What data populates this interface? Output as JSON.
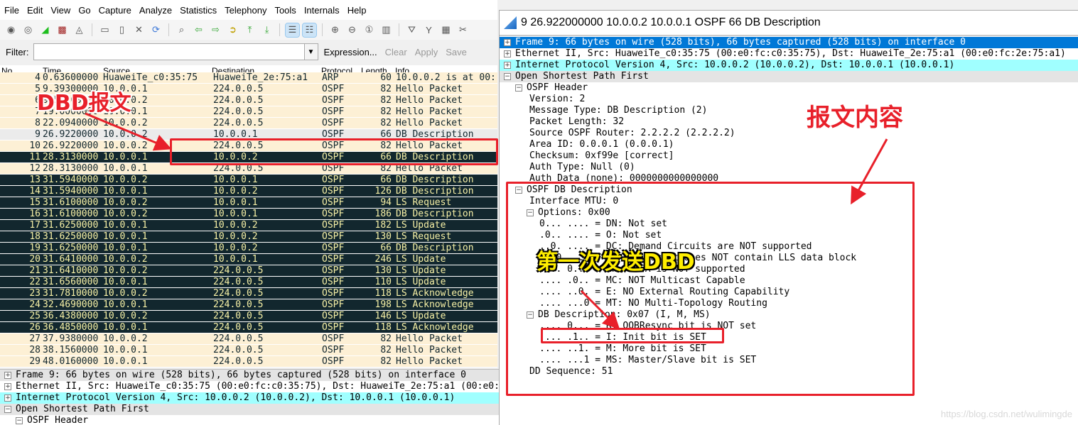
{
  "menu": [
    "File",
    "Edit",
    "View",
    "Go",
    "Capture",
    "Analyze",
    "Statistics",
    "Telephony",
    "Tools",
    "Internals",
    "Help"
  ],
  "toolbar_icons": [
    "interfaces-icon",
    "options-icon",
    "start-capture-icon",
    "stop-capture-icon",
    "restart-capture-icon",
    "open-file-icon",
    "save-file-icon",
    "close-file-icon",
    "reload-icon",
    "find-icon",
    "back-icon",
    "forward-icon",
    "goto-icon",
    "first-packet-icon",
    "last-packet-icon",
    "colorize-icon",
    "autoscroll-icon",
    "zoom-in-icon",
    "zoom-out-icon",
    "zoom-normal-icon",
    "resize-columns-icon",
    "capture-filters-icon",
    "display-filters-icon",
    "coloring-rules-icon",
    "preferences-icon"
  ],
  "filter": {
    "label": "Filter:",
    "value": "",
    "expression": "Expression...",
    "clear": "Clear",
    "apply": "Apply",
    "save": "Save"
  },
  "columns": [
    "No.",
    "Time",
    "Source",
    "Destination",
    "Protocol",
    "Length",
    "Info"
  ],
  "packets": [
    {
      "no": "4",
      "time": "0.63600000",
      "src": "HuaweiTe_c0:35:75",
      "dst": "HuaweiTe_2e:75:a1",
      "proto": "ARP",
      "len": "60",
      "info": "10.0.0.2 is at 00:",
      "style": "light"
    },
    {
      "no": "5",
      "time": "9.39300000",
      "src": "10.0.0.1",
      "dst": "224.0.0.5",
      "proto": "OSPF",
      "len": "82",
      "info": "Hello Packet",
      "style": "light"
    },
    {
      "no": "6",
      "time": "9.50000000",
      "src": "10.0.0.2",
      "dst": "224.0.0.5",
      "proto": "OSPF",
      "len": "82",
      "info": "Hello Packet",
      "style": "light"
    },
    {
      "no": "7",
      "time": "19.0000000",
      "src": "10.0.0.1",
      "dst": "224.0.0.5",
      "proto": "OSPF",
      "len": "82",
      "info": "Hello Packet",
      "style": "light"
    },
    {
      "no": "8",
      "time": "22.0940000",
      "src": "10.0.0.2",
      "dst": "224.0.0.5",
      "proto": "OSPF",
      "len": "82",
      "info": "Hello Packet",
      "style": "light"
    },
    {
      "no": "9",
      "time": "26.9220000",
      "src": "10.0.0.2",
      "dst": "10.0.0.1",
      "proto": "OSPF",
      "len": "66",
      "info": "DB Description",
      "style": "gray"
    },
    {
      "no": "10",
      "time": "26.9220000",
      "src": "10.0.0.2",
      "dst": "224.0.0.5",
      "proto": "OSPF",
      "len": "82",
      "info": "Hello Packet",
      "style": "light"
    },
    {
      "no": "11",
      "time": "28.3130000",
      "src": "10.0.0.1",
      "dst": "10.0.0.2",
      "proto": "OSPF",
      "len": "66",
      "info": "DB Description",
      "style": "dark"
    },
    {
      "no": "12",
      "time": "28.3130000",
      "src": "10.0.0.1",
      "dst": "224.0.0.5",
      "proto": "OSPF",
      "len": "82",
      "info": "Hello Packet",
      "style": "light"
    },
    {
      "no": "13",
      "time": "31.5940000",
      "src": "10.0.0.2",
      "dst": "10.0.0.1",
      "proto": "OSPF",
      "len": "66",
      "info": "DB Description",
      "style": "dark"
    },
    {
      "no": "14",
      "time": "31.5940000",
      "src": "10.0.0.1",
      "dst": "10.0.0.2",
      "proto": "OSPF",
      "len": "126",
      "info": "DB Description",
      "style": "dark"
    },
    {
      "no": "15",
      "time": "31.6100000",
      "src": "10.0.0.2",
      "dst": "10.0.0.1",
      "proto": "OSPF",
      "len": "94",
      "info": "LS Request",
      "style": "dark"
    },
    {
      "no": "16",
      "time": "31.6100000",
      "src": "10.0.0.2",
      "dst": "10.0.0.1",
      "proto": "OSPF",
      "len": "186",
      "info": "DB Description",
      "style": "dark"
    },
    {
      "no": "17",
      "time": "31.6250000",
      "src": "10.0.0.1",
      "dst": "10.0.0.2",
      "proto": "OSPF",
      "len": "182",
      "info": "LS Update",
      "style": "dark"
    },
    {
      "no": "18",
      "time": "31.6250000",
      "src": "10.0.0.1",
      "dst": "10.0.0.2",
      "proto": "OSPF",
      "len": "130",
      "info": "LS Request",
      "style": "dark"
    },
    {
      "no": "19",
      "time": "31.6250000",
      "src": "10.0.0.1",
      "dst": "10.0.0.2",
      "proto": "OSPF",
      "len": "66",
      "info": "DB Description",
      "style": "dark"
    },
    {
      "no": "20",
      "time": "31.6410000",
      "src": "10.0.0.2",
      "dst": "10.0.0.1",
      "proto": "OSPF",
      "len": "246",
      "info": "LS Update",
      "style": "dark"
    },
    {
      "no": "21",
      "time": "31.6410000",
      "src": "10.0.0.2",
      "dst": "224.0.0.5",
      "proto": "OSPF",
      "len": "130",
      "info": "LS Update",
      "style": "dark"
    },
    {
      "no": "22",
      "time": "31.6560000",
      "src": "10.0.0.1",
      "dst": "224.0.0.5",
      "proto": "OSPF",
      "len": "110",
      "info": "LS Update",
      "style": "dark"
    },
    {
      "no": "23",
      "time": "31.7810000",
      "src": "10.0.0.2",
      "dst": "224.0.0.5",
      "proto": "OSPF",
      "len": "118",
      "info": "LS Acknowledge",
      "style": "dark"
    },
    {
      "no": "24",
      "time": "32.4690000",
      "src": "10.0.0.1",
      "dst": "224.0.0.5",
      "proto": "OSPF",
      "len": "198",
      "info": "LS Acknowledge",
      "style": "dark"
    },
    {
      "no": "25",
      "time": "36.4380000",
      "src": "10.0.0.2",
      "dst": "224.0.0.5",
      "proto": "OSPF",
      "len": "146",
      "info": "LS Update",
      "style": "dark"
    },
    {
      "no": "26",
      "time": "36.4850000",
      "src": "10.0.0.1",
      "dst": "224.0.0.5",
      "proto": "OSPF",
      "len": "118",
      "info": "LS Acknowledge",
      "style": "dark"
    },
    {
      "no": "27",
      "time": "37.9380000",
      "src": "10.0.0.2",
      "dst": "224.0.0.5",
      "proto": "OSPF",
      "len": "82",
      "info": "Hello Packet",
      "style": "light"
    },
    {
      "no": "28",
      "time": "38.1560000",
      "src": "10.0.0.1",
      "dst": "224.0.0.5",
      "proto": "OSPF",
      "len": "82",
      "info": "Hello Packet",
      "style": "light"
    },
    {
      "no": "29",
      "time": "48.0160000",
      "src": "10.0.0.1",
      "dst": "224.0.0.5",
      "proto": "OSPF",
      "len": "82",
      "info": "Hello Packet",
      "style": "light"
    }
  ],
  "bottom_tree": [
    {
      "text": "Frame 9: 66 bytes on wire (528 bits), 66 bytes captured (528 bits) on interface 0",
      "exp": "+",
      "indent": 0,
      "style": "grayb"
    },
    {
      "text": "Ethernet II, Src: HuaweiTe_c0:35:75 (00:e0:fc:c0:35:75), Dst: HuaweiTe_2e:75:a1 (00:e0:fc:2e:75:a1)",
      "exp": "+",
      "indent": 0,
      "style": ""
    },
    {
      "text": "Internet Protocol Version 4, Src: 10.0.0.2 (10.0.0.2), Dst: 10.0.0.1 (10.0.0.1)",
      "exp": "+",
      "indent": 0,
      "style": "cyan"
    },
    {
      "text": "Open Shortest Path First",
      "exp": "-",
      "indent": 0,
      "style": "grayb"
    },
    {
      "text": "OSPF Header",
      "exp": "-",
      "indent": 1,
      "style": ""
    }
  ],
  "detail_window": {
    "title": "9 26.922000000 10.0.0.2 10.0.0.1 OSPF 66 DB Description",
    "tree": [
      {
        "text": "Frame 9: 66 bytes on wire (528 bits), 66 bytes captured (528 bits) on interface 0",
        "exp": "+",
        "indent": 0,
        "style": "sel"
      },
      {
        "text": "Ethernet II, Src: HuaweiTe_c0:35:75 (00:e0:fc:c0:35:75), Dst: HuaweiTe_2e:75:a1 (00:e0:fc:2e:75:a1)",
        "exp": "+",
        "indent": 0,
        "style": ""
      },
      {
        "text": "Internet Protocol Version 4, Src: 10.0.0.2 (10.0.0.2), Dst: 10.0.0.1 (10.0.0.1)",
        "exp": "+",
        "indent": 0,
        "style": "cyan"
      },
      {
        "text": "Open Shortest Path First",
        "exp": "-",
        "indent": 0,
        "style": "grayb"
      },
      {
        "text": "OSPF Header",
        "exp": "-",
        "indent": 1,
        "style": ""
      },
      {
        "text": "Version: 2",
        "exp": "",
        "indent": 2,
        "style": ""
      },
      {
        "text": "Message Type: DB Description (2)",
        "exp": "",
        "indent": 2,
        "style": ""
      },
      {
        "text": "Packet Length: 32",
        "exp": "",
        "indent": 2,
        "style": ""
      },
      {
        "text": "Source OSPF Router: 2.2.2.2 (2.2.2.2)",
        "exp": "",
        "indent": 2,
        "style": ""
      },
      {
        "text": "Area ID: 0.0.0.1 (0.0.0.1)",
        "exp": "",
        "indent": 2,
        "style": ""
      },
      {
        "text": "Checksum: 0xf99e [correct]",
        "exp": "",
        "indent": 2,
        "style": ""
      },
      {
        "text": "Auth Type: Null (0)",
        "exp": "",
        "indent": 2,
        "style": ""
      },
      {
        "text": "Auth Data (none): 0000000000000000",
        "exp": "",
        "indent": 2,
        "style": ""
      },
      {
        "text": "OSPF DB Description",
        "exp": "-",
        "indent": 1,
        "style": ""
      },
      {
        "text": "Interface MTU: 0",
        "exp": "",
        "indent": 2,
        "style": ""
      },
      {
        "text": "Options: 0x00",
        "exp": "-",
        "indent": 2,
        "style": ""
      },
      {
        "text": "0... .... = DN: Not set",
        "exp": "",
        "indent": 3,
        "style": ""
      },
      {
        "text": ".0.. .... = O: Not set",
        "exp": "",
        "indent": 3,
        "style": ""
      },
      {
        "text": "..0. .... = DC: Demand Circuits are NOT supported",
        "exp": "",
        "indent": 3,
        "style": ""
      },
      {
        "text": "...0 .... = L: The packet does NOT contain LLS data block",
        "exp": "",
        "indent": 3,
        "style": ""
      },
      {
        "text": ".... 0... = NP: NSSA is NOT supported",
        "exp": "",
        "indent": 3,
        "style": ""
      },
      {
        "text": ".... .0.. = MC: NOT Multicast Capable",
        "exp": "",
        "indent": 3,
        "style": ""
      },
      {
        "text": ".... ..0. = E: NO External Routing Capability",
        "exp": "",
        "indent": 3,
        "style": ""
      },
      {
        "text": ".... ...0 = MT: NO Multi-Topology Routing",
        "exp": "",
        "indent": 3,
        "style": ""
      },
      {
        "text": "DB Description: 0x07 (I, M, MS)",
        "exp": "-",
        "indent": 2,
        "style": ""
      },
      {
        "text": ".... 0... = R: OOBResync bit is NOT set",
        "exp": "",
        "indent": 3,
        "style": ""
      },
      {
        "text": ".... .1.. = I: Init bit is SET",
        "exp": "",
        "indent": 3,
        "style": ""
      },
      {
        "text": ".... ..1. = M: More bit is SET",
        "exp": "",
        "indent": 3,
        "style": ""
      },
      {
        "text": ".... ...1 = MS: Master/Slave bit is SET",
        "exp": "",
        "indent": 3,
        "style": ""
      },
      {
        "text": "DD Sequence: 51",
        "exp": "",
        "indent": 2,
        "style": ""
      }
    ]
  },
  "annotations": {
    "dbd_label": "DBD报文",
    "content_label": "报文内容",
    "first_dbd_label": "第一次发送DBD",
    "color": "#e8202a"
  },
  "watermark": "https://blog.csdn.net/wulimingde"
}
